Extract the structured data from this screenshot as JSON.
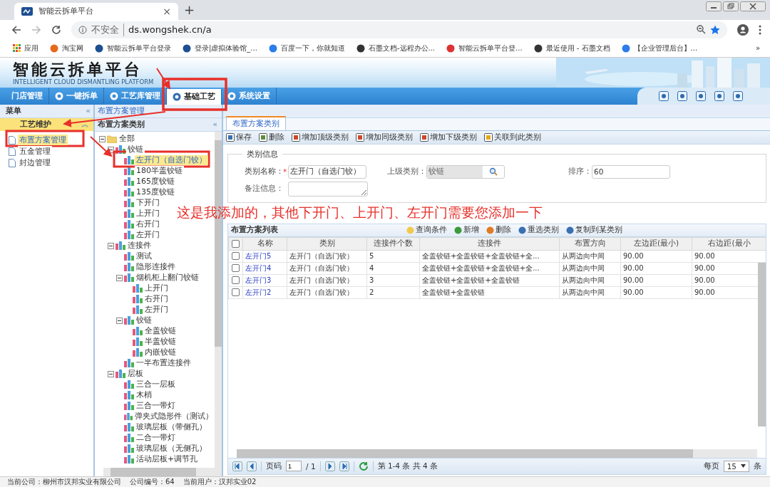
{
  "browser": {
    "tab_title": "智能云拆单平台",
    "tab_close": "×",
    "new_tab": "+",
    "security": "不安全",
    "url": "ds.wongshek.cn/a",
    "bookmarks": [
      "应用",
      "淘宝网",
      "智能云拆单平台登录",
      "登录|虚拟体验馆_...",
      "百度一下，你就知道",
      "石墨文档-远程办公...",
      "智能云拆单平台登...",
      "最近使用 - 石墨文档",
      "【企业管理后台】..."
    ],
    "more": "»"
  },
  "header": {
    "title": "智能云拆单平台",
    "subtitle": "INTELLIGENT CLOUD DISMANTLING PLATFORM"
  },
  "nav_tabs": [
    {
      "label": "门店管理",
      "has_icon": false,
      "selected": false
    },
    {
      "label": "一键拆单",
      "has_icon": true,
      "selected": false
    },
    {
      "label": "工艺库管理",
      "has_icon": true,
      "selected": false
    },
    {
      "label": "基础工艺",
      "has_icon": true,
      "selected": true
    },
    {
      "label": "系统设置",
      "has_icon": true,
      "selected": false
    }
  ],
  "menu": {
    "title": "菜单",
    "collapse": "«",
    "section": "工艺维护",
    "section_toggle": "︽",
    "items": [
      {
        "label": "布置方案管理",
        "selected": true
      },
      {
        "label": "五金管理",
        "selected": false
      },
      {
        "label": "封边管理",
        "selected": false
      }
    ]
  },
  "breadcrumb": "布置方案管理",
  "tree": {
    "title": "布置方案类别",
    "collapse": "«",
    "nodes": [
      {
        "label": "全部",
        "kind": "folder",
        "selected": false,
        "expanded": true,
        "children": [
          {
            "label": "铰链",
            "kind": "chart",
            "selected": false,
            "expanded": true,
            "children": [
              {
                "label": "左开门（自选门铰）",
                "kind": "chart",
                "selected": true
              },
              {
                "label": "180半盖铰链",
                "kind": "chart",
                "selected": false
              },
              {
                "label": "165度铰链",
                "kind": "chart",
                "selected": false
              },
              {
                "label": "135度铰链",
                "kind": "chart",
                "selected": false
              },
              {
                "label": "下开门",
                "kind": "chart",
                "selected": false
              },
              {
                "label": "上开门",
                "kind": "chart",
                "selected": false
              },
              {
                "label": "右开门",
                "kind": "chart",
                "selected": false
              },
              {
                "label": "左开门",
                "kind": "chart",
                "selected": false
              }
            ]
          },
          {
            "label": "连接件",
            "kind": "chart",
            "selected": false,
            "expanded": true,
            "children": [
              {
                "label": "测试",
                "kind": "chart",
                "selected": false
              },
              {
                "label": "隐形连接件",
                "kind": "chart",
                "selected": false
              },
              {
                "label": "烟机柜上翻门铰链",
                "kind": "chart",
                "selected": false,
                "expanded": true,
                "children": [
                  {
                    "label": "上开门",
                    "kind": "chart",
                    "selected": false
                  },
                  {
                    "label": "右开门",
                    "kind": "chart",
                    "selected": false
                  },
                  {
                    "label": "左开门",
                    "kind": "chart",
                    "selected": false
                  }
                ]
              },
              {
                "label": "铰链",
                "kind": "chart",
                "selected": false,
                "expanded": true,
                "children": [
                  {
                    "label": "全盖铰链",
                    "kind": "chart",
                    "selected": false
                  },
                  {
                    "label": "半盖铰链",
                    "kind": "chart",
                    "selected": false
                  },
                  {
                    "label": "内嵌铰链",
                    "kind": "chart",
                    "selected": false
                  }
                ]
              },
              {
                "label": "一半布置连接件",
                "kind": "chart",
                "selected": false
              }
            ]
          },
          {
            "label": "层板",
            "kind": "chart",
            "selected": false,
            "expanded": true,
            "children": [
              {
                "label": "三合一层板",
                "kind": "chart",
                "selected": false
              },
              {
                "label": "木梢",
                "kind": "chart",
                "selected": false
              },
              {
                "label": "三合一带灯",
                "kind": "chart",
                "selected": false
              },
              {
                "label": "弹夹式隐形件（测试）",
                "kind": "chart",
                "selected": false
              },
              {
                "label": "玻璃层板（带侧孔）",
                "kind": "chart",
                "selected": false
              },
              {
                "label": "二合一带灯",
                "kind": "chart",
                "selected": false
              },
              {
                "label": "玻璃层板（无侧孔）",
                "kind": "chart",
                "selected": false
              },
              {
                "label": "活动层板+调节孔",
                "kind": "chart",
                "selected": false
              }
            ]
          }
        ]
      }
    ]
  },
  "main_tab": {
    "label": "布置方案类别",
    "selected": true
  },
  "toolbar": [
    "保存",
    "删除",
    "增加顶级类别",
    "增加同级类别",
    "增加下级类别",
    "关联到此类别"
  ],
  "form": {
    "legend": "类别信息",
    "fields": [
      {
        "label": "类别名称：",
        "required": true,
        "required_mark": "*",
        "kind": "text",
        "value": "左开门（自选门铰）",
        "disabled": false
      },
      {
        "label": "上级类别：",
        "required": false,
        "kind": "lookup",
        "value": "铰链",
        "disabled": true
      },
      {
        "label": "排序：",
        "required": false,
        "kind": "text",
        "value": "60",
        "disabled": false
      },
      {
        "label": "备注信息：",
        "required": false,
        "kind": "textarea",
        "disabled": false
      }
    ]
  },
  "list": {
    "title": "布置方案列表",
    "all_checked": false,
    "actions": [
      "查询条件",
      "新增",
      "删除",
      "重选类别",
      "复制到某类别"
    ],
    "columns": [
      "名称",
      "类别",
      "连接件个数",
      "连接件",
      "布置方向",
      "左边距(最小)",
      "右边距(最小"
    ],
    "rows": [
      {
        "checked": false,
        "cells": [
          "左开门5",
          "左开门（自选门铰）",
          "5",
          "全盖铰链+全盖铰链+全盖铰链+全...",
          "从两边向中间",
          "90.00",
          "90.00"
        ]
      },
      {
        "checked": false,
        "cells": [
          "左开门4",
          "左开门（自选门铰）",
          "4",
          "全盖铰链+全盖铰链+全盖铰链+全...",
          "从两边向中间",
          "90.00",
          "90.00"
        ]
      },
      {
        "checked": false,
        "cells": [
          "左开门3",
          "左开门（自选门铰）",
          "3",
          "全盖铰链+全盖铰链+全盖铰链",
          "从两边向中间",
          "90.00",
          "90.00"
        ]
      },
      {
        "checked": false,
        "cells": [
          "左开门2",
          "左开门（自选门铰）",
          "2",
          "全盖铰链+全盖铰链",
          "从两边向中间",
          "90.00",
          "90.00"
        ]
      }
    ]
  },
  "pager": {
    "page_label": "页码",
    "page": "1",
    "total_pages": "/ 1",
    "summary": "第 1-4 条  共 4 条",
    "per_page_label": "每页",
    "per_page": "15",
    "per_page_unit": "条"
  },
  "status_bar": [
    "当前公司：柳州市汉邦实业有限公司",
    "公司编号：64",
    "当前用户：汉邦实业02"
  ],
  "annotation": "这是我添加的，其他下开门、上开门、左开门需要您添加一下"
}
